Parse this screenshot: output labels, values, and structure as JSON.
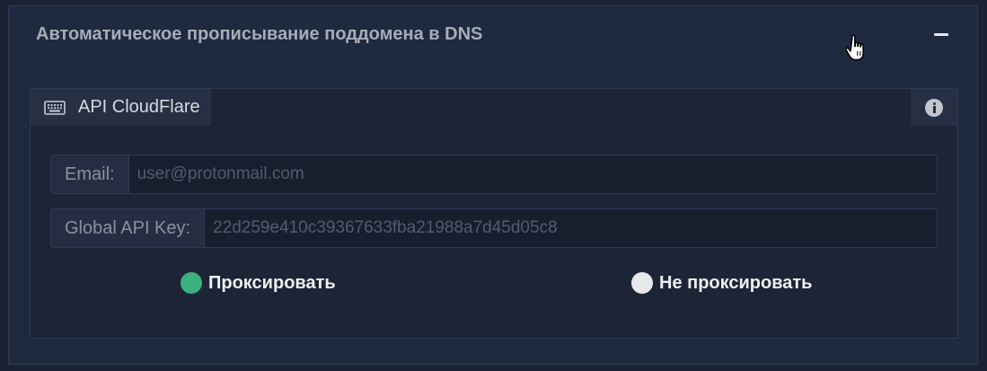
{
  "section": {
    "title": "Автоматическое прописывание поддомена в DNS",
    "collapse_icon": "minus-icon"
  },
  "panel": {
    "tab_label": "API CloudFlare",
    "tab_icon": "keyboard-icon",
    "info_icon": "info-icon"
  },
  "form": {
    "email": {
      "label": "Email:",
      "value": "",
      "placeholder": "user@protonmail.com"
    },
    "api_key": {
      "label": "Global API Key:",
      "value": "",
      "placeholder": "22d259e410c39367633fba21988a7d45d05c8"
    }
  },
  "proxy_options": [
    {
      "label": "Проксировать",
      "selected": true,
      "color": "#3ab17e"
    },
    {
      "label": "Не проксировать",
      "selected": false,
      "color": "#e8e9ec"
    }
  ]
}
